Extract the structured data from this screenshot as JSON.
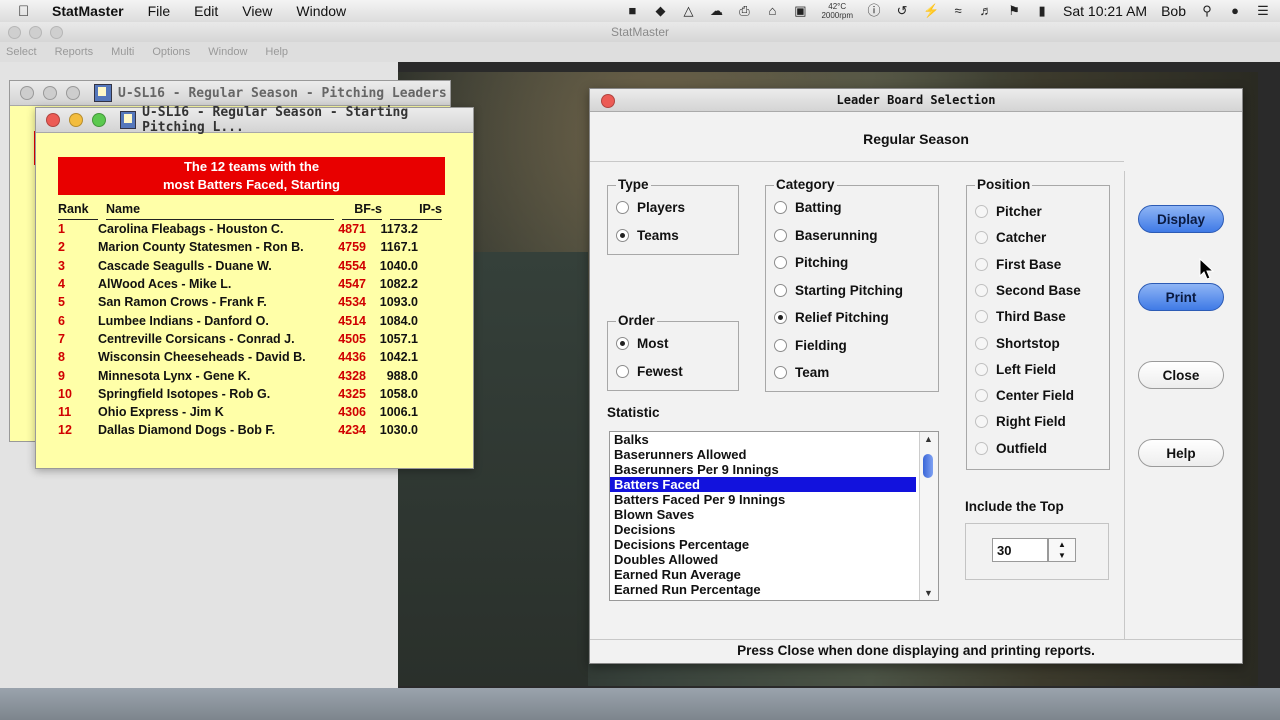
{
  "menubar": {
    "app_name": "StatMaster",
    "menus": [
      "File",
      "Edit",
      "View",
      "Window"
    ],
    "temperature": "42°C",
    "rpm": "2000rpm",
    "clock": "Sat 10:21 AM",
    "user": "Bob"
  },
  "app_title": "StatMaster",
  "app_menu": [
    "Select",
    "Reports",
    "Multi",
    "Options",
    "Window",
    "Help"
  ],
  "pitching_window": {
    "title": "U-SL16 - Regular Season - Pitching Leaders"
  },
  "starting_window": {
    "title": "U-SL16 - Regular Season - Starting Pitching L...",
    "banner_line1": "The 12 teams with the",
    "banner_line2": "most Batters Faced, Starting",
    "headers": {
      "rank": "Rank",
      "name": "Name",
      "bf": "BF-s",
      "ip": "IP-s"
    },
    "rows": [
      {
        "rank": "1",
        "name": "Carolina Fleabags - Houston C.",
        "bf": "4871",
        "ip": "1173.2"
      },
      {
        "rank": "2",
        "name": "Marion County Statesmen - Ron B.",
        "bf": "4759",
        "ip": "1167.1"
      },
      {
        "rank": "3",
        "name": "Cascade Seagulls - Duane W.",
        "bf": "4554",
        "ip": "1040.0"
      },
      {
        "rank": "4",
        "name": "AlWood Aces - Mike L.",
        "bf": "4547",
        "ip": "1082.2"
      },
      {
        "rank": "5",
        "name": "San Ramon Crows - Frank F.",
        "bf": "4534",
        "ip": "1093.0"
      },
      {
        "rank": "6",
        "name": "Lumbee Indians - Danford O.",
        "bf": "4514",
        "ip": "1084.0"
      },
      {
        "rank": "7",
        "name": "Centreville Corsicans - Conrad J.",
        "bf": "4505",
        "ip": "1057.1"
      },
      {
        "rank": "8",
        "name": "Wisconsin Cheeseheads - David B.",
        "bf": "4436",
        "ip": "1042.1"
      },
      {
        "rank": "9",
        "name": "Minnesota Lynx - Gene K.",
        "bf": "4328",
        "ip": "988.0"
      },
      {
        "rank": "10",
        "name": "Springfield Isotopes - Rob G.",
        "bf": "4325",
        "ip": "1058.0"
      },
      {
        "rank": "11",
        "name": "Ohio Express - Jim K",
        "bf": "4306",
        "ip": "1006.1"
      },
      {
        "rank": "12",
        "name": "Dallas Diamond Dogs - Bob F.",
        "bf": "4234",
        "ip": "1030.0"
      }
    ]
  },
  "leader_board": {
    "title": "Leader Board Selection",
    "season": "Regular Season",
    "type_label": "Type",
    "type_options": [
      {
        "label": "Players",
        "selected": false
      },
      {
        "label": "Teams",
        "selected": true
      }
    ],
    "order_label": "Order",
    "order_options": [
      {
        "label": "Most",
        "selected": true
      },
      {
        "label": "Fewest",
        "selected": false
      }
    ],
    "category_label": "Category",
    "category_options": [
      {
        "label": "Batting",
        "selected": false
      },
      {
        "label": "Baserunning",
        "selected": false
      },
      {
        "label": "Pitching",
        "selected": false
      },
      {
        "label": "Starting Pitching",
        "selected": false
      },
      {
        "label": "Relief Pitching",
        "selected": true
      },
      {
        "label": "Fielding",
        "selected": false
      },
      {
        "label": "Team",
        "selected": false
      }
    ],
    "position_label": "Position",
    "position_options": [
      "Pitcher",
      "Catcher",
      "First Base",
      "Second Base",
      "Third Base",
      "Shortstop",
      "Left Field",
      "Center Field",
      "Right Field",
      "Outfield"
    ],
    "statistic_label": "Statistic",
    "statistics": [
      "Balks",
      "Baserunners Allowed",
      "Baserunners Per 9 Innings",
      "Batters Faced",
      "Batters Faced Per 9 Innings",
      "Blown Saves",
      "Decisions",
      "Decisions Percentage",
      "Doubles Allowed",
      "Earned Run Average",
      "Earned Run Percentage"
    ],
    "selected_statistic": "Batters Faced",
    "include_top_label": "Include the Top",
    "include_top_value": "30",
    "buttons": {
      "display": "Display",
      "print": "Print",
      "close": "Close",
      "help": "Help"
    },
    "status": "Press Close when done displaying and printing reports."
  }
}
